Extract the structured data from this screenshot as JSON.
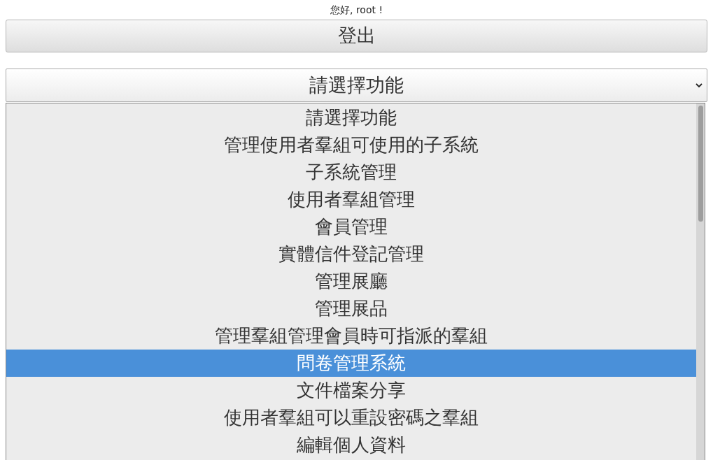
{
  "greeting": "您好, root !",
  "logout_button": "登出",
  "select": {
    "value": "請選擇功能"
  },
  "options": [
    {
      "label": "請選擇功能",
      "selected": false
    },
    {
      "label": "管理使用者羣組可使用的子系統",
      "selected": false
    },
    {
      "label": "子系統管理",
      "selected": false
    },
    {
      "label": "使用者羣組管理",
      "selected": false
    },
    {
      "label": "會員管理",
      "selected": false
    },
    {
      "label": "實體信件登記管理",
      "selected": false
    },
    {
      "label": "管理展廳",
      "selected": false
    },
    {
      "label": "管理展品",
      "selected": false
    },
    {
      "label": "管理羣組管理會員時可指派的羣組",
      "selected": false
    },
    {
      "label": "問卷管理系統",
      "selected": true
    },
    {
      "label": "文件檔案分享",
      "selected": false
    },
    {
      "label": "使用者羣組可以重設密碼之羣組",
      "selected": false
    },
    {
      "label": "編輯個人資料",
      "selected": false
    }
  ]
}
